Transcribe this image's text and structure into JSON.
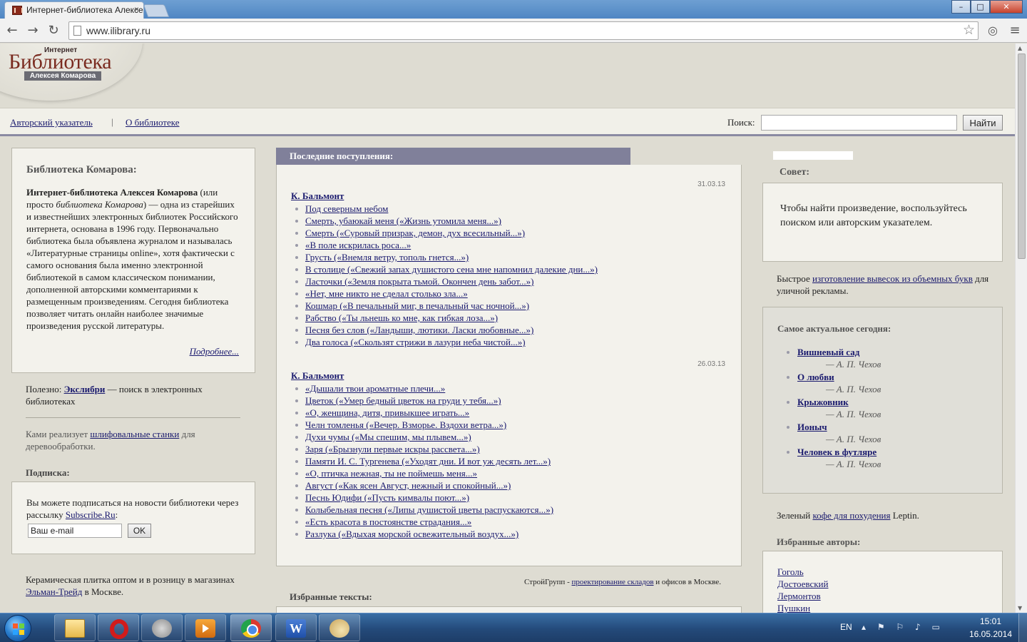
{
  "browser": {
    "tab_title": "Интернет-библиотека Алексея Комарова",
    "tab_close": "×",
    "url": "www.ilibrary.ru",
    "window_buttons": {
      "minimize": "–",
      "maximize": "□",
      "close": "✕"
    },
    "icons": {
      "back": "arrow-left",
      "forward": "arrow-right",
      "reload": "reload",
      "star": "star",
      "extension": "extension",
      "menu": "hamburger"
    }
  },
  "header": {
    "logo_small": "Интернет",
    "logo_big": "Библиотека",
    "logo_strip": "Алексея Комарова"
  },
  "menu": {
    "authors_index": "Авторский указатель",
    "separator": "|",
    "about": "О библиотеке",
    "search_label": "Поиск:",
    "search_button": "Найти"
  },
  "left": {
    "about_title": "Библиотека Комарова:",
    "about_bold": "Интернет-библиотека Алексея Комарова",
    "about_t1": " (или просто ",
    "about_italic": "библиотека Комарова",
    "about_t2": ") — одна из старейших и известнейших электронных библиотек Российского интернета, основана в 1996 году. Первоначально библиотека была объявлена журналом и называлась «Литературные страницы online», хотя фактически с самого основания была именно электронной библиотекой в самом классическом понимании, дополненной авторскими комментариями к размещенным произведениям. Сегодня библиотека позволяет читать онлайн наиболее значимые произведения русской литературы.",
    "about_more": "Подробнее...",
    "useful_prefix": "Полезно: ",
    "useful_link": "Экслибри",
    "useful_suffix": " — поиск в электронных библиотеках",
    "ad1_prefix": "Ками реализует ",
    "ad1_link": "шлифовальные станки",
    "ad1_suffix": " для деревообработки.",
    "subscription_title": "Подписка:",
    "subscription_text": "Вы можете подписаться на новости библиотеки через рассылку ",
    "subscription_link": "Subscribe.Ru",
    "subscription_colon": ":",
    "email_value": "Ваш e-mail",
    "ok_button": "OK",
    "ad2_prefix": "Керамическая плитка оптом и в розницу в магазинах ",
    "ad2_link": "Эльман-Трейд",
    "ad2_suffix": " в Москве."
  },
  "latest": {
    "title": "Последние поступления:",
    "entries": [
      {
        "date": "31.03.13",
        "author": "К. Бальмонт",
        "works": [
          "Под северным небом",
          "Смерть, убаюкай меня («Жизнь утомила меня...»)",
          "Смерть («Суровый призрак, демон, дух всесильный...»)",
          "«В поле искрилась роса...»",
          "Грусть («Внемля ветру, тополь гнется...»)",
          "В столице («Свежий запах душистого сена мне напомнил далекие дни...»)",
          "Ласточки («Земля покрыта тьмой. Окончен день забот...»)",
          "«Нет, мне никто не сделал столько зла...»",
          "Кошмар («В печальный миг, в печальный час ночной...»)",
          "Рабство («Ты льнешь ко мне, как гибкая лоза...»)",
          "Песня без слов («Ландыши, лютики. Ласки любовные...»)",
          "Два голоса («Скользят стрижи в лазури неба чистой...»)"
        ]
      },
      {
        "date": "26.03.13",
        "author": "К. Бальмонт",
        "works": [
          "«Дышали твои ароматные плечи...»",
          "Цветок («Умер бедный цветок на груди у тебя...»)",
          "«О, женщина, дитя, привыкшее играть...»",
          "Челн томленья («Вечер. Взморье. Вздохи ветра...»)",
          "Духи чумы («Мы спешим, мы плывем...»)",
          "Заря («Брызнули первые искры рассвета...»)",
          "Памяти И. С. Тургенева («Уходят дни. И вот уж десять лет...»)",
          "«О, птичка нежная, ты не поймешь меня...»",
          "Август («Как ясен Август, нежный и спокойный...»)",
          "Песнь Юдифи («Пусть кимвалы поют...»)",
          "Колыбельная песня («Липы душистой цветы распускаются...»)",
          "«Есть красота в постоянстве страдания...»",
          "Разлука («Вдыхая морской освежительный воздух...»)"
        ]
      }
    ],
    "stroy_prefix": "СтройГрупп - ",
    "stroy_link": "проектирование складов",
    "stroy_suffix": " и офисов в Москве.",
    "favorite_texts_title": "Избранные тексты:"
  },
  "right": {
    "tip_title": "Совет:",
    "tip_text": "Чтобы найти произведение, воспользуйтесь поиском или авторским указателем.",
    "ad3_prefix": "Быстрое ",
    "ad3_link": "изготовление вывесок из объемных букв",
    "ad3_suffix": " для уличной рекламы.",
    "actual_title": "Самое актуальное сегодня:",
    "actual_items": [
      {
        "title": "Вишневый сад",
        "author": "— А. П. Чехов"
      },
      {
        "title": "О любви",
        "author": "— А. П. Чехов"
      },
      {
        "title": "Крыжовник",
        "author": "— А. П. Чехов"
      },
      {
        "title": "Ионыч",
        "author": "— А. П. Чехов"
      },
      {
        "title": "Человек в футляре",
        "author": "— А. П. Чехов"
      }
    ],
    "ad4_prefix": "Зеленый ",
    "ad4_link": "кофе для похудения",
    "ad4_suffix": " Leptin.",
    "authors_title": "Избранные авторы:",
    "authors": [
      "Гоголь",
      "Достоевский",
      "Лермонтов",
      "Пушкин"
    ]
  },
  "taskbar": {
    "lang": "EN",
    "tray_icons": "▴ ⚑ ⚐ ♪ ▭",
    "time": "15:01",
    "date": "16.05.2014",
    "apps": [
      "explorer-icon",
      "opera-icon",
      "tool-icon",
      "media-player-icon",
      "chrome-icon",
      "word-icon",
      "paint-icon"
    ],
    "word_glyph": "W"
  }
}
